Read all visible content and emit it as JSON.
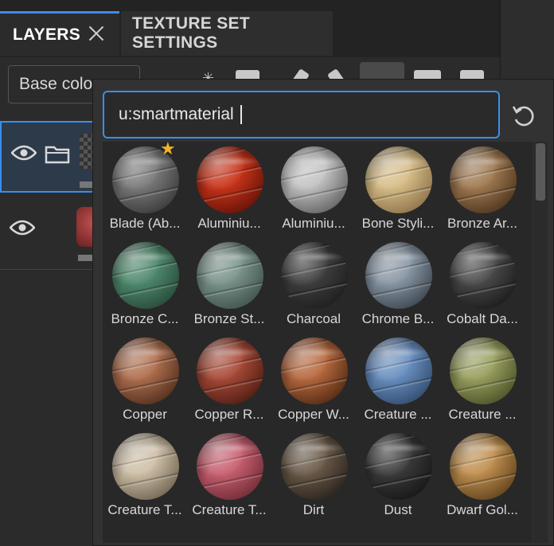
{
  "tabs": {
    "layers": "LAYERS",
    "texture_set_settings": "TEXTURE SET SETTINGS"
  },
  "channel_select": {
    "value": "Base colo"
  },
  "search": {
    "value": "u:smartmaterial"
  },
  "materials": [
    {
      "label": "Blade (Ab...",
      "color": "#7a7a7a",
      "dark": "#2a2a2a",
      "favorite": true
    },
    {
      "label": "Aluminiu...",
      "color": "#c8341a",
      "dark": "#4a0a04",
      "favorite": false
    },
    {
      "label": "Aluminiu...",
      "color": "#c4c4c4",
      "dark": "#4a4a4a",
      "favorite": false
    },
    {
      "label": "Bone Styli...",
      "color": "#d8be8a",
      "dark": "#7a6038",
      "favorite": false
    },
    {
      "label": "Bronze Ar...",
      "color": "#a07a52",
      "dark": "#3a2410",
      "favorite": false
    },
    {
      "label": "Bronze C...",
      "color": "#4f8a6e",
      "dark": "#1e3a2c",
      "favorite": false
    },
    {
      "label": "Bronze St...",
      "color": "#7a948c",
      "dark": "#33423e",
      "favorite": false
    },
    {
      "label": "Charcoal",
      "color": "#3e3e3e",
      "dark": "#161616",
      "favorite": false
    },
    {
      "label": "Chrome B...",
      "color": "#8a98a6",
      "dark": "#2a323a",
      "favorite": false
    },
    {
      "label": "Cobalt Da...",
      "color": "#4a4a4a",
      "dark": "#101010",
      "favorite": false
    },
    {
      "label": "Copper",
      "color": "#b07050",
      "dark": "#3a1e10",
      "favorite": false
    },
    {
      "label": "Copper R...",
      "color": "#a84a38",
      "dark": "#3a120a",
      "favorite": false
    },
    {
      "label": "Copper W...",
      "color": "#b86a40",
      "dark": "#3a1a08",
      "favorite": false
    },
    {
      "label": "Creature ...",
      "color": "#6a90c0",
      "dark": "#243a5a",
      "favorite": false
    },
    {
      "label": "Creature ...",
      "color": "#9aa060",
      "dark": "#3a3e1a",
      "favorite": false
    },
    {
      "label": "Creature T...",
      "color": "#cfc0a8",
      "dark": "#5a4e3c",
      "favorite": false
    },
    {
      "label": "Creature T...",
      "color": "#c86070",
      "dark": "#5a1e28",
      "favorite": false
    },
    {
      "label": "Dirt",
      "color": "#6a5a48",
      "dark": "#1a1612",
      "favorite": false
    },
    {
      "label": "Dust",
      "color": "#3a3a3a",
      "dark": "#0e0e0e",
      "favorite": false
    },
    {
      "label": "Dwarf Gol...",
      "color": "#c09050",
      "dark": "#4a3010",
      "favorite": false
    }
  ],
  "icons": {
    "close": "close-icon",
    "eye": "eye-icon",
    "folder": "folder-icon",
    "reset": "refresh-icon",
    "favorite": "star-icon"
  },
  "colors": {
    "accent": "#3b8ee8",
    "star": "#f0b429"
  }
}
